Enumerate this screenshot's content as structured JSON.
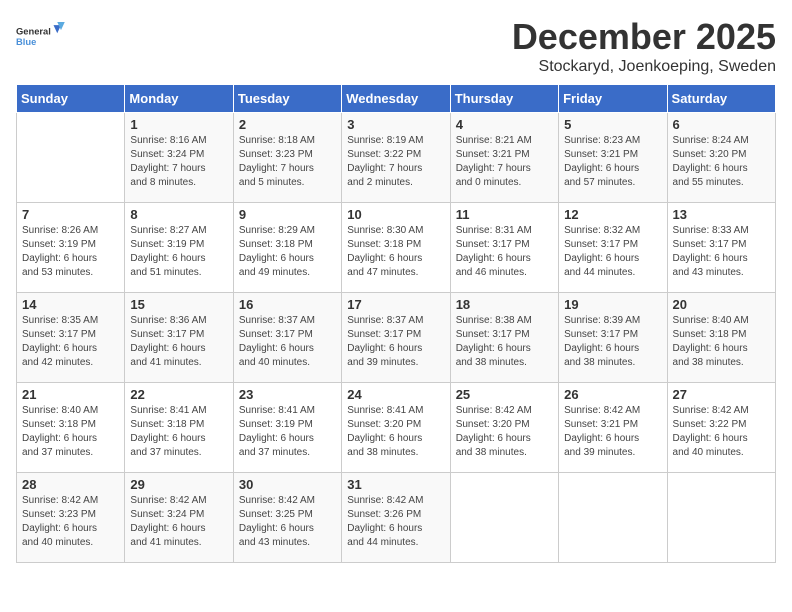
{
  "logo": {
    "general": "General",
    "blue": "Blue"
  },
  "title": "December 2025",
  "location": "Stockaryd, Joenkoeping, Sweden",
  "weekdays": [
    "Sunday",
    "Monday",
    "Tuesday",
    "Wednesday",
    "Thursday",
    "Friday",
    "Saturday"
  ],
  "weeks": [
    [
      {
        "day": "",
        "info": ""
      },
      {
        "day": "1",
        "info": "Sunrise: 8:16 AM\nSunset: 3:24 PM\nDaylight: 7 hours\nand 8 minutes."
      },
      {
        "day": "2",
        "info": "Sunrise: 8:18 AM\nSunset: 3:23 PM\nDaylight: 7 hours\nand 5 minutes."
      },
      {
        "day": "3",
        "info": "Sunrise: 8:19 AM\nSunset: 3:22 PM\nDaylight: 7 hours\nand 2 minutes."
      },
      {
        "day": "4",
        "info": "Sunrise: 8:21 AM\nSunset: 3:21 PM\nDaylight: 7 hours\nand 0 minutes."
      },
      {
        "day": "5",
        "info": "Sunrise: 8:23 AM\nSunset: 3:21 PM\nDaylight: 6 hours\nand 57 minutes."
      },
      {
        "day": "6",
        "info": "Sunrise: 8:24 AM\nSunset: 3:20 PM\nDaylight: 6 hours\nand 55 minutes."
      }
    ],
    [
      {
        "day": "7",
        "info": "Sunrise: 8:26 AM\nSunset: 3:19 PM\nDaylight: 6 hours\nand 53 minutes."
      },
      {
        "day": "8",
        "info": "Sunrise: 8:27 AM\nSunset: 3:19 PM\nDaylight: 6 hours\nand 51 minutes."
      },
      {
        "day": "9",
        "info": "Sunrise: 8:29 AM\nSunset: 3:18 PM\nDaylight: 6 hours\nand 49 minutes."
      },
      {
        "day": "10",
        "info": "Sunrise: 8:30 AM\nSunset: 3:18 PM\nDaylight: 6 hours\nand 47 minutes."
      },
      {
        "day": "11",
        "info": "Sunrise: 8:31 AM\nSunset: 3:17 PM\nDaylight: 6 hours\nand 46 minutes."
      },
      {
        "day": "12",
        "info": "Sunrise: 8:32 AM\nSunset: 3:17 PM\nDaylight: 6 hours\nand 44 minutes."
      },
      {
        "day": "13",
        "info": "Sunrise: 8:33 AM\nSunset: 3:17 PM\nDaylight: 6 hours\nand 43 minutes."
      }
    ],
    [
      {
        "day": "14",
        "info": "Sunrise: 8:35 AM\nSunset: 3:17 PM\nDaylight: 6 hours\nand 42 minutes."
      },
      {
        "day": "15",
        "info": "Sunrise: 8:36 AM\nSunset: 3:17 PM\nDaylight: 6 hours\nand 41 minutes."
      },
      {
        "day": "16",
        "info": "Sunrise: 8:37 AM\nSunset: 3:17 PM\nDaylight: 6 hours\nand 40 minutes."
      },
      {
        "day": "17",
        "info": "Sunrise: 8:37 AM\nSunset: 3:17 PM\nDaylight: 6 hours\nand 39 minutes."
      },
      {
        "day": "18",
        "info": "Sunrise: 8:38 AM\nSunset: 3:17 PM\nDaylight: 6 hours\nand 38 minutes."
      },
      {
        "day": "19",
        "info": "Sunrise: 8:39 AM\nSunset: 3:17 PM\nDaylight: 6 hours\nand 38 minutes."
      },
      {
        "day": "20",
        "info": "Sunrise: 8:40 AM\nSunset: 3:18 PM\nDaylight: 6 hours\nand 38 minutes."
      }
    ],
    [
      {
        "day": "21",
        "info": "Sunrise: 8:40 AM\nSunset: 3:18 PM\nDaylight: 6 hours\nand 37 minutes."
      },
      {
        "day": "22",
        "info": "Sunrise: 8:41 AM\nSunset: 3:18 PM\nDaylight: 6 hours\nand 37 minutes."
      },
      {
        "day": "23",
        "info": "Sunrise: 8:41 AM\nSunset: 3:19 PM\nDaylight: 6 hours\nand 37 minutes."
      },
      {
        "day": "24",
        "info": "Sunrise: 8:41 AM\nSunset: 3:20 PM\nDaylight: 6 hours\nand 38 minutes."
      },
      {
        "day": "25",
        "info": "Sunrise: 8:42 AM\nSunset: 3:20 PM\nDaylight: 6 hours\nand 38 minutes."
      },
      {
        "day": "26",
        "info": "Sunrise: 8:42 AM\nSunset: 3:21 PM\nDaylight: 6 hours\nand 39 minutes."
      },
      {
        "day": "27",
        "info": "Sunrise: 8:42 AM\nSunset: 3:22 PM\nDaylight: 6 hours\nand 40 minutes."
      }
    ],
    [
      {
        "day": "28",
        "info": "Sunrise: 8:42 AM\nSunset: 3:23 PM\nDaylight: 6 hours\nand 40 minutes."
      },
      {
        "day": "29",
        "info": "Sunrise: 8:42 AM\nSunset: 3:24 PM\nDaylight: 6 hours\nand 41 minutes."
      },
      {
        "day": "30",
        "info": "Sunrise: 8:42 AM\nSunset: 3:25 PM\nDaylight: 6 hours\nand 43 minutes."
      },
      {
        "day": "31",
        "info": "Sunrise: 8:42 AM\nSunset: 3:26 PM\nDaylight: 6 hours\nand 44 minutes."
      },
      {
        "day": "",
        "info": ""
      },
      {
        "day": "",
        "info": ""
      },
      {
        "day": "",
        "info": ""
      }
    ]
  ]
}
